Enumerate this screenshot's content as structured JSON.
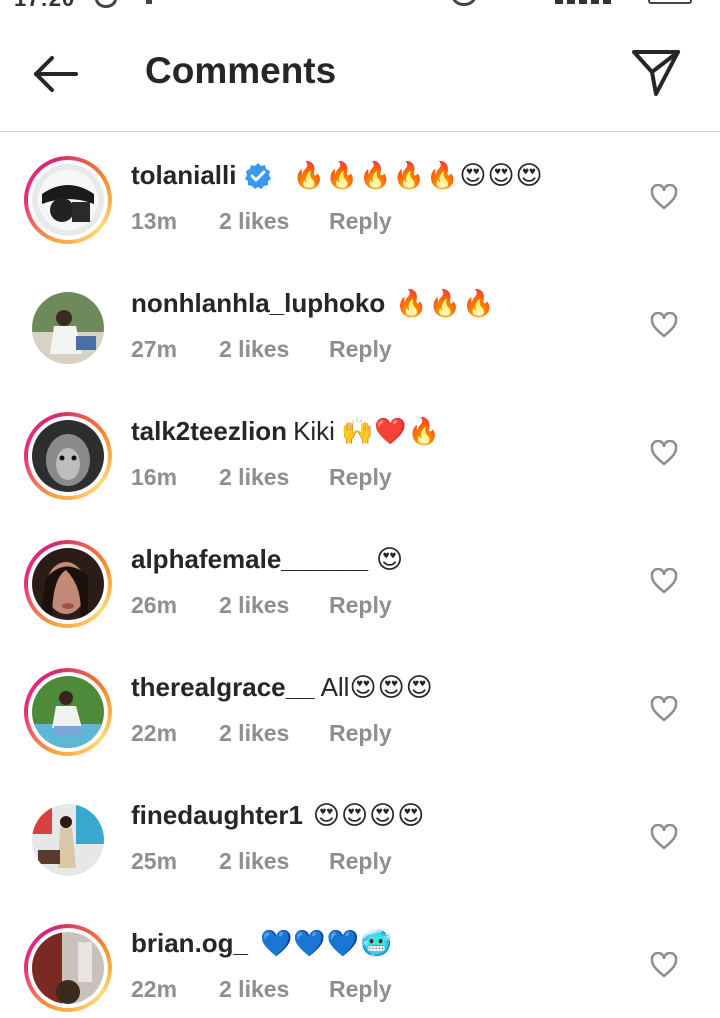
{
  "status_bar": {
    "time": "17:20"
  },
  "header": {
    "back_icon": "arrow-left-icon",
    "title": "Comments",
    "send_icon": "paper-plane-icon"
  },
  "colors": {
    "text": "#262626",
    "meta": "#8e8e8e",
    "verified": "#3897f0",
    "divider": "#dbdbdb"
  },
  "comments": [
    {
      "username": "tolanialli",
      "verified": true,
      "text": "",
      "emojis": "🔥🔥🔥🔥🔥😍😍😍",
      "time": "13m",
      "likes": "2 likes",
      "reply": "Reply",
      "story_ring": true
    },
    {
      "username": "nonhlanhla_luphoko",
      "verified": false,
      "text": "",
      "emojis": "🔥🔥🔥",
      "time": "27m",
      "likes": "2 likes",
      "reply": "Reply",
      "story_ring": false
    },
    {
      "username": "talk2teezlion",
      "verified": false,
      "text": "Kiki",
      "emojis": "🙌❤️🔥",
      "time": "16m",
      "likes": "2 likes",
      "reply": "Reply",
      "story_ring": true
    },
    {
      "username": "alphafemale______",
      "verified": false,
      "text": "",
      "emojis": "😍",
      "time": "26m",
      "likes": "2 likes",
      "reply": "Reply",
      "story_ring": true
    },
    {
      "username": "therealgrace__",
      "verified": false,
      "text": "All",
      "emojis": "😍😍😍",
      "time": "22m",
      "likes": "2 likes",
      "reply": "Reply",
      "story_ring": true
    },
    {
      "username": "finedaughter1",
      "verified": false,
      "text": "",
      "emojis": "😍😍😍😍",
      "time": "25m",
      "likes": "2 likes",
      "reply": "Reply",
      "story_ring": false
    },
    {
      "username": "brian.og_",
      "verified": false,
      "text": "",
      "emojis": "💙💙💙🥶",
      "time": "22m",
      "likes": "2 likes",
      "reply": "Reply",
      "story_ring": true
    }
  ]
}
